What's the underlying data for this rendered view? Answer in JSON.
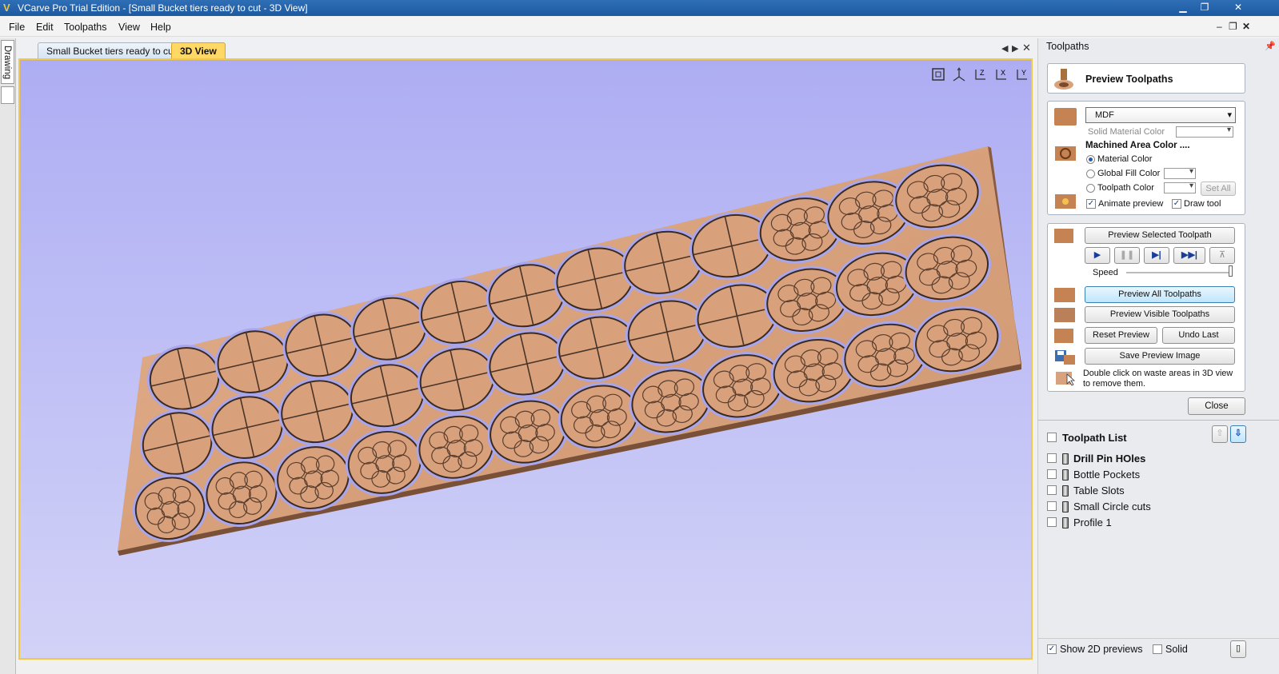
{
  "window": {
    "title": "VCarve Pro Trial Edition - [Small Bucket tiers ready to cut - 3D View]"
  },
  "menu": [
    "File",
    "Edit",
    "Toolpaths",
    "View",
    "Help"
  ],
  "left_strip": {
    "drawing_tab": "Drawing"
  },
  "doc_tabs": [
    {
      "label": "Small Bucket tiers ready to cut",
      "active": false
    },
    {
      "label": "3D View",
      "active": true
    }
  ],
  "panel": {
    "header": "Toolpaths",
    "preview_title": "Preview Toolpaths",
    "material_select": "MDF",
    "solid_material_color_label": "Solid Material Color",
    "machined_area_label": "Machined Area Color ....",
    "options": {
      "material_color": "Material Color",
      "global_fill_color": "Global Fill Color",
      "toolpath_color": "Toolpath Color",
      "set_all": "Set All"
    },
    "animate_preview": "Animate preview",
    "draw_tool": "Draw tool",
    "buttons": {
      "preview_selected": "Preview Selected Toolpath",
      "preview_all": "Preview All Toolpaths",
      "preview_visible": "Preview Visible Toolpaths",
      "reset_preview": "Reset Preview",
      "undo_last": "Undo Last",
      "save_preview_image": "Save Preview Image",
      "close": "Close"
    },
    "speed_label": "Speed",
    "hint": "Double click on waste areas in 3D view to remove them.",
    "toolpath_list_title": "Toolpath List",
    "toolpaths": [
      "Drill Pin HOles",
      "Bottle Pockets",
      "Table Slots",
      "Small Circle cuts",
      "Profile 1"
    ],
    "bottom": {
      "show_2d_previews": "Show 2D previews",
      "solid": "Solid"
    }
  },
  "colors": {
    "viewport_top": "#aeadf3",
    "board": "#d9a27e",
    "tab_active": "#ffd866",
    "titlebar": "#1c5aa0"
  }
}
